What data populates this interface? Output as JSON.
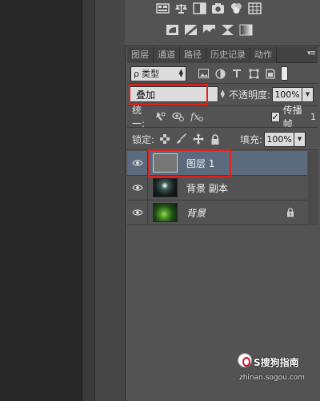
{
  "adjustments": {
    "row1_icons": [
      "levels-icon",
      "balance-icon",
      "bw-icon",
      "camera-filter-icon",
      "channel-mixer-icon",
      "grid-lookup-icon"
    ],
    "row2_icons": [
      "invert-icon",
      "posterize-icon",
      "threshold-icon",
      "selective-color-icon",
      "gradient-map-icon"
    ]
  },
  "tabs": [
    {
      "label": "图层",
      "active": true
    },
    {
      "label": "通道",
      "active": false
    },
    {
      "label": "路径",
      "active": false
    },
    {
      "label": "历史记录",
      "active": false
    },
    {
      "label": "动作",
      "active": false
    }
  ],
  "panel_menu": "▾≡",
  "filter": {
    "prefix": "ρ",
    "kind": "类型",
    "icons": [
      "image-filter-icon",
      "adjust-filter-icon",
      "type-filter-icon",
      "shape-filter-icon",
      "smart-filter-icon"
    ]
  },
  "blend": {
    "mode": "叠加",
    "opacity_label": "不透明度:",
    "opacity_value": "100%"
  },
  "unify": {
    "label": "统一:",
    "propagate_label": "传播帧",
    "propagate_num": "1",
    "propagate_checked": "✓"
  },
  "lock": {
    "label": "锁定:",
    "fill_label": "填充:",
    "fill_value": "100%"
  },
  "layers": [
    {
      "name": "图层 1",
      "thumb": "gray",
      "selected": true,
      "italic": false,
      "locked": false
    },
    {
      "name": "背景 副本",
      "thumb": "img1",
      "selected": false,
      "italic": false,
      "locked": false
    },
    {
      "name": "背景",
      "thumb": "img2",
      "selected": false,
      "italic": true,
      "locked": true
    }
  ],
  "watermark": {
    "main": "S搜狗指南",
    "sub": "zhinan.sogou.com"
  },
  "colors": {
    "highlight_red": "#e0211c",
    "selected_row": "#5c6a7e",
    "panel_bg": "#535353"
  }
}
